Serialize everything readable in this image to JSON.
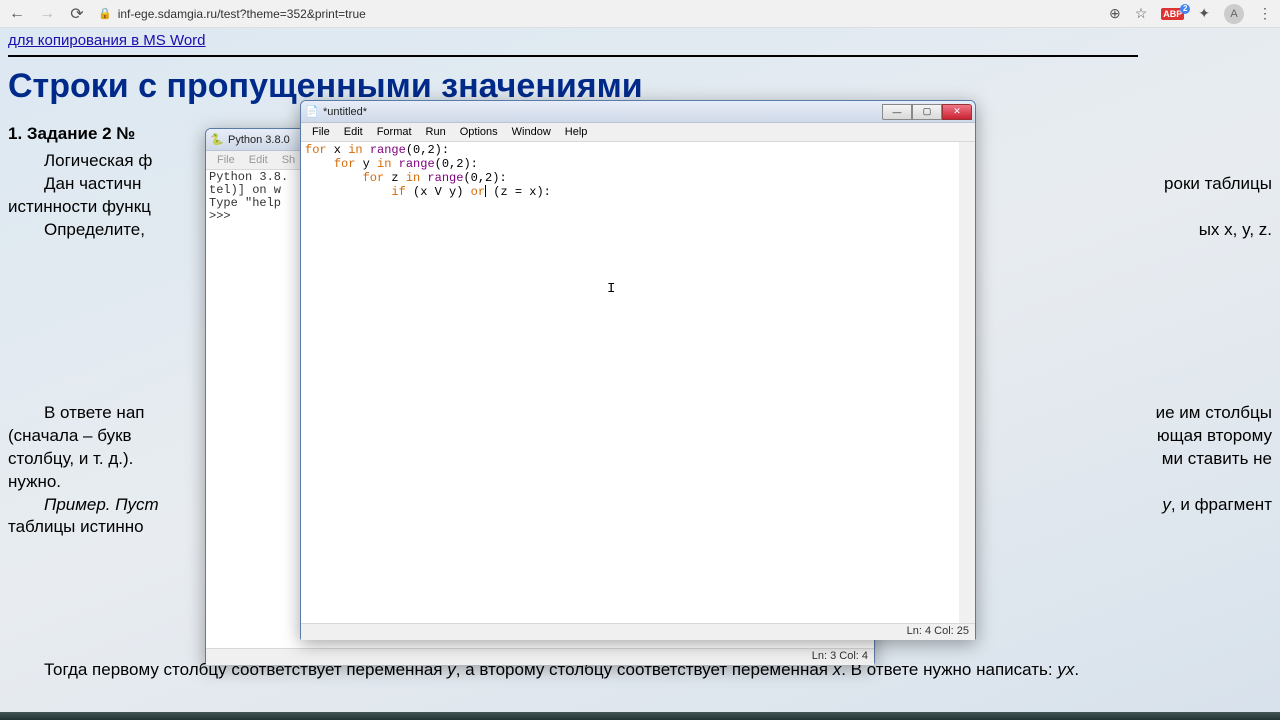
{
  "browser": {
    "url": "inf-ege.sdamgia.ru/test?theme=352&print=true",
    "abp_count": "2",
    "avatar_letter": "A"
  },
  "page": {
    "link_text": "для копирования в MS Word",
    "heading": "Строки с пропущенными значениями",
    "task_no": "1. Задание 2 №",
    "p1a": "Логическая ф",
    "p1b": "Дан  частичн",
    "p1c": "истинности функц",
    "p1d": "Определите,",
    "p1b_right": "роки  таблицы",
    "p1d_right": "ых x, y, z.",
    "p2a": "В ответе нап",
    "p2b": "(сначала – букв",
    "p2c": "столбцу, и т. д.).",
    "p2d": "нужно.",
    "p2e": "Пример. Пуст",
    "p2f": "таблицы истинно",
    "p2a_right": "ие им столбцы",
    "p2b_right": "ющая второму",
    "p2c_right": "ми ставить не",
    "p2e_right": "y, и фрагмент",
    "p3": "Тогда первому столбцу соответствует переменная y, а второму столбцу соответствует переменная x. В ответе нужно написать: yx.",
    "p3_indent": "     "
  },
  "shell": {
    "title": "Python 3.8.0",
    "menus": [
      "File",
      "Edit",
      "Sh"
    ],
    "line1": "Python 3.8.",
    "line2": "tel)] on w",
    "line3": "Type \"help",
    "prompt": ">>>",
    "status": "Ln: 3  Col: 4"
  },
  "editor": {
    "title": "*untitled*",
    "menus": [
      "File",
      "Edit",
      "Format",
      "Run",
      "Options",
      "Window",
      "Help"
    ],
    "code": {
      "l1_kw1": "for",
      "l1_v": " x ",
      "l1_kw2": "in",
      "l1_fn": " range",
      "l1_r": "(0,2):",
      "l2_kw1": "for",
      "l2_v": " y ",
      "l2_kw2": "in",
      "l2_fn": " range",
      "l2_r": "(0,2):",
      "l3_kw1": "for",
      "l3_v": " z ",
      "l3_kw2": "in",
      "l3_fn": " range",
      "l3_r": "(0,2):",
      "l4_kw1": "if",
      "l4_a": " (x ",
      "l4_or1": "V",
      "l4_b": " y) ",
      "l4_or2": "or",
      "l4_c": " (z ",
      "l4_eq": "=",
      "l4_d": " x):"
    },
    "status": "Ln: 4  Col: 25"
  }
}
